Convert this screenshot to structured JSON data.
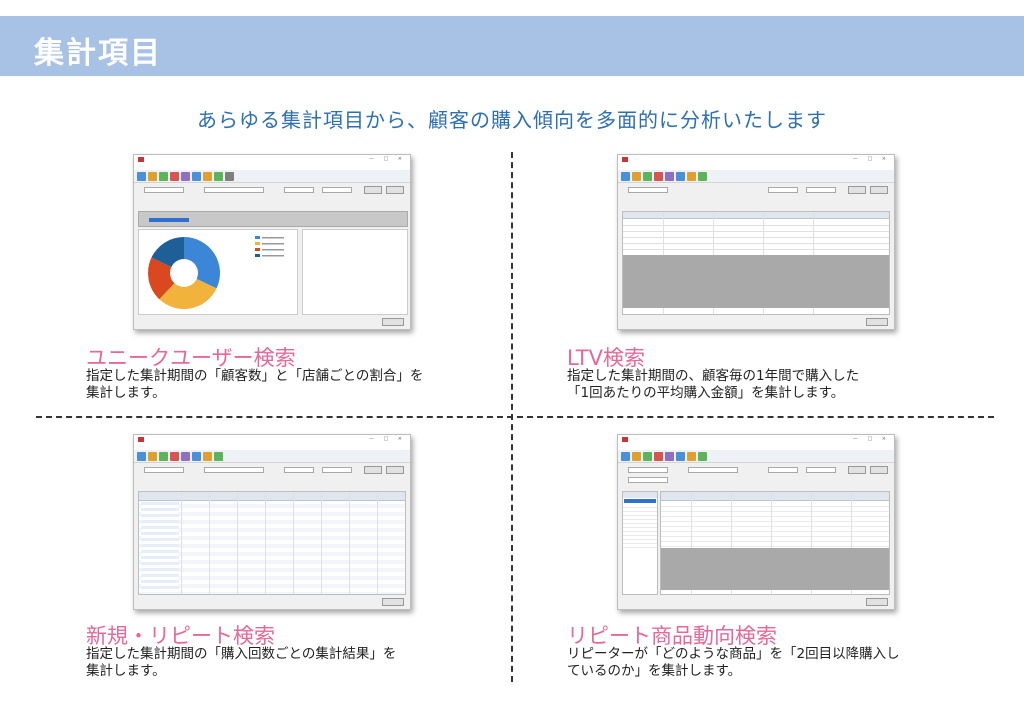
{
  "header": {
    "title": "集計項目",
    "subtitle": "あらゆる集計項目から、顧客の購入傾向を多面的に分析いたします"
  },
  "sections": [
    {
      "title": "ユニークユーザー検索",
      "desc_line1": "指定した集計期間の「顧客数」と「店舗ごとの割合」を",
      "desc_line2": "集計します。"
    },
    {
      "title": "LTV検索",
      "desc_line1": "指定した集計期間の、顧客毎の1年間で購入した",
      "desc_line2": "「1回あたりの平均購入金額」を集計します。"
    },
    {
      "title": "新規・リピート検索",
      "desc_line1": "指定した集計期間の「購入回数ごとの集計結果」を",
      "desc_line2": "集計します。"
    },
    {
      "title": "リピート商品動向検索",
      "desc_line1": "リピーターが「どのような商品」を「2回目以降購入し",
      "desc_line2": "ているのか」を集計します。"
    }
  ],
  "pie_colors": [
    "#3b86d6",
    "#f2b33d",
    "#d9481f",
    "#1f5f97"
  ],
  "colors": {
    "banner": "#a8c2e6",
    "subtitle": "#2c6fb3",
    "section_title": "#e6689a"
  }
}
